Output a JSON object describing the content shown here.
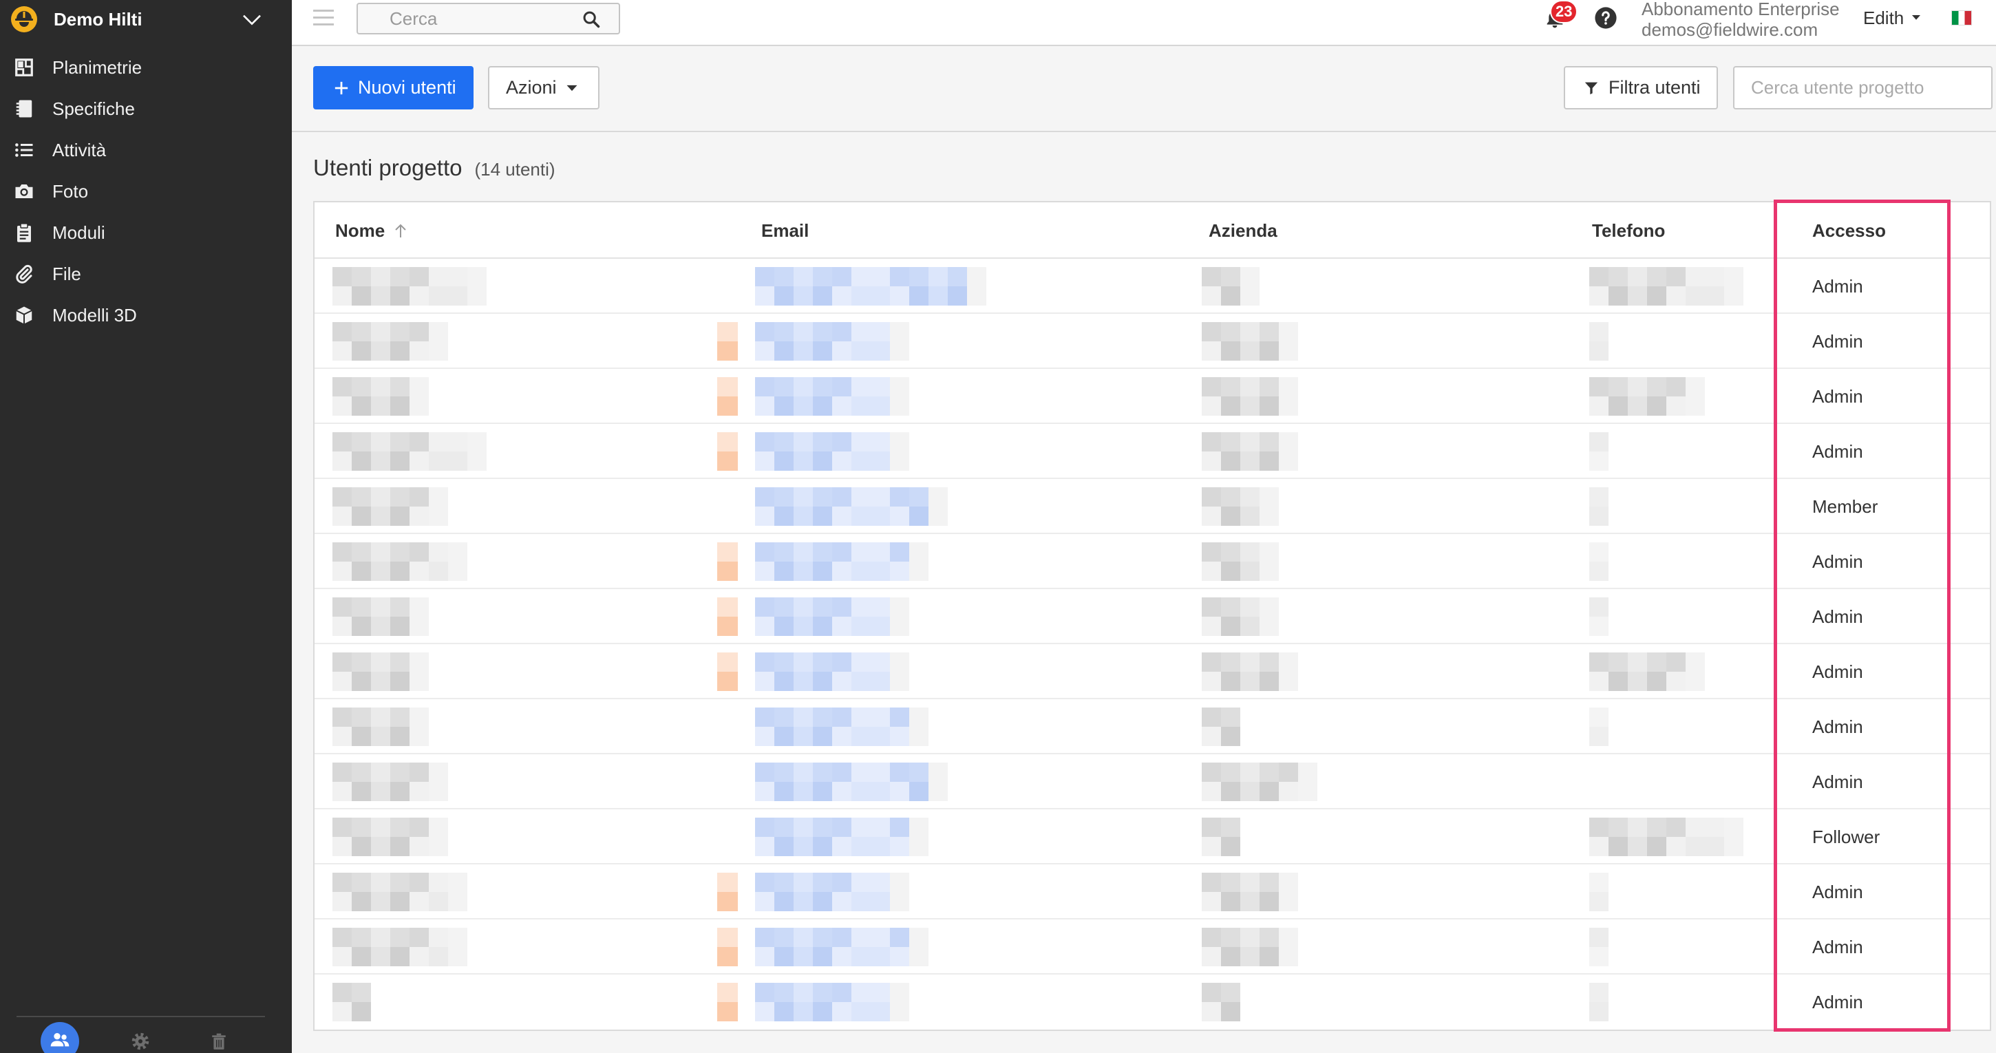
{
  "sidebar": {
    "project_name": "Demo Hilti",
    "project_icon": "worker-helmet-logo-icon",
    "items": [
      {
        "label": "Planimetrie",
        "icon": "floorplan-icon"
      },
      {
        "label": "Specifiche",
        "icon": "notebook-icon"
      },
      {
        "label": "Attività",
        "icon": "task-list-icon"
      },
      {
        "label": "Foto",
        "icon": "camera-icon"
      },
      {
        "label": "Moduli",
        "icon": "clipboard-icon"
      },
      {
        "label": "File",
        "icon": "paperclip-icon"
      },
      {
        "label": "Modelli 3D",
        "icon": "cube-icon"
      }
    ],
    "footer_icons": [
      "users-icon",
      "gear-icon",
      "trash-icon"
    ],
    "active_footer_icon": "users-icon"
  },
  "topbar": {
    "menu_icon": "hamburger-icon",
    "search_placeholder": "Cerca",
    "notifications_count": "23",
    "plan_label": "Abbonamento Enterprise",
    "account_email": "demos@fieldwire.com",
    "user_name": "Edith",
    "language_icon": "italy-flag-icon"
  },
  "toolbar": {
    "new_users_label": "Nuovi utenti",
    "actions_label": "Azioni",
    "filter_label": "Filtra utenti",
    "user_search_placeholder": "Cerca utente progetto"
  },
  "page": {
    "title": "Utenti progetto",
    "user_count": "(14 utenti)"
  },
  "table": {
    "columns": [
      "Nome",
      "Email",
      "Azienda",
      "Telefono",
      "Accesso"
    ],
    "sort_icon": "arrow-up-icon",
    "rows": [
      {
        "access": "Admin"
      },
      {
        "access": "Admin"
      },
      {
        "access": "Admin"
      },
      {
        "access": "Admin"
      },
      {
        "access": "Member"
      },
      {
        "access": "Admin"
      },
      {
        "access": "Admin"
      },
      {
        "access": "Admin"
      },
      {
        "access": "Admin"
      },
      {
        "access": "Admin"
      },
      {
        "access": "Follower"
      },
      {
        "access": "Admin"
      },
      {
        "access": "Admin"
      },
      {
        "access": "Admin"
      }
    ]
  },
  "colors": {
    "primary_button": "#1f6ff2",
    "sidebar_background": "#2b2b2b",
    "notification_badge": "#e3262d",
    "active_footer_icon": "#3d7be8",
    "highlight_box": "#e8356f"
  }
}
